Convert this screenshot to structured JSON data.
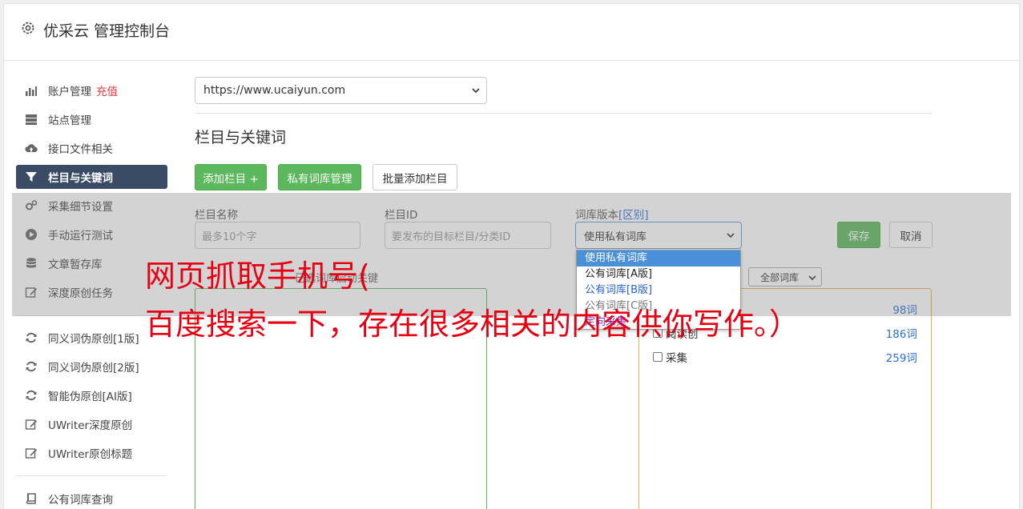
{
  "header": {
    "title": "优采云 管理控制台"
  },
  "sidebar": {
    "items": [
      {
        "label": "账户管理",
        "icon": "bar-chart-icon",
        "badge": "充值"
      },
      {
        "label": "站点管理",
        "icon": "server-icon"
      },
      {
        "label": "接口文件相关",
        "icon": "cloud-upload-icon"
      },
      {
        "label": "栏目与关键词",
        "icon": "filter-icon",
        "active": true
      },
      {
        "label": "采集细节设置",
        "icon": "gears-icon"
      },
      {
        "label": "手动运行测试",
        "icon": "play-circle-icon"
      },
      {
        "label": "文章暂存库",
        "icon": "database-icon"
      },
      {
        "label": "深度原创任务",
        "icon": "edit-icon"
      },
      {
        "label": "同义词伪原创[1版]",
        "icon": "refresh-icon"
      },
      {
        "label": "同义词伪原创[2版]",
        "icon": "refresh-icon"
      },
      {
        "label": "智能伪原创[AI版]",
        "icon": "refresh-icon"
      },
      {
        "label": "UWriter深度原创",
        "icon": "edit-icon"
      },
      {
        "label": "UWriter原创标题",
        "icon": "edit-icon"
      },
      {
        "label": "公有词库查询",
        "icon": "book-icon"
      }
    ]
  },
  "main": {
    "site_select": "https://www.ucaiyun.com",
    "section_title": "栏目与关键词",
    "buttons": {
      "add_column": "添加栏目 +",
      "private_lib": "私有词库管理",
      "batch_add": "批量添加栏目"
    },
    "form": {
      "name_label": "栏目名称",
      "name_placeholder": "最多10个字",
      "id_label": "栏目ID",
      "id_placeholder": "要发布的目标栏目/分类ID",
      "version_label": "词库版本",
      "version_link": "[区别]",
      "version_value": "使用私有词库",
      "save": "保存",
      "cancel": "取消"
    },
    "dropdown_options": [
      "使用私有词库",
      "公有词库[A版]",
      "公有词库[B版]",
      "公有词库[C版]",
      "定向采集"
    ],
    "left_panel_label": "已选词库启动关键",
    "lib_filter": "全部词库",
    "lib_rows": [
      {
        "name": "",
        "count": "98词"
      },
      {
        "name": "阅读创",
        "count": "186词"
      },
      {
        "name": "采集",
        "count": "259词"
      }
    ]
  },
  "overlay_text": {
    "line1": "网页抓取手机号(",
    "line2": "百度搜索一下，存在很多相关的内容供你写作。）"
  }
}
